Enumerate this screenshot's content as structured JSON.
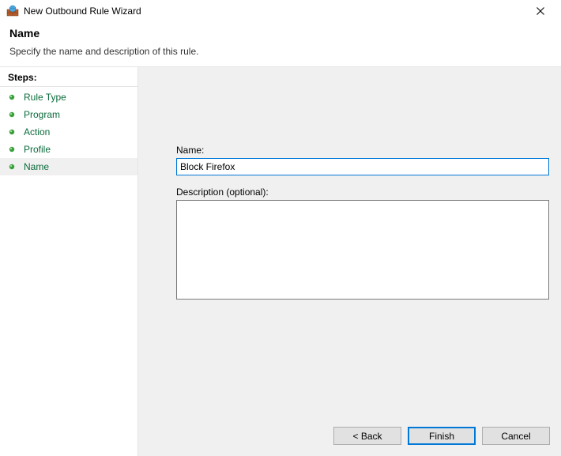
{
  "window": {
    "title": "New Outbound Rule Wizard"
  },
  "header": {
    "title": "Name",
    "subtitle": "Specify the name and description of this rule."
  },
  "sidebar": {
    "header": "Steps:",
    "items": [
      {
        "label": "Rule Type"
      },
      {
        "label": "Program"
      },
      {
        "label": "Action"
      },
      {
        "label": "Profile"
      },
      {
        "label": "Name"
      }
    ],
    "active_index": 4
  },
  "form": {
    "name_label": "Name:",
    "name_value": "Block Firefox",
    "description_label": "Description (optional):",
    "description_value": ""
  },
  "buttons": {
    "back": "< Back",
    "finish": "Finish",
    "cancel": "Cancel"
  }
}
